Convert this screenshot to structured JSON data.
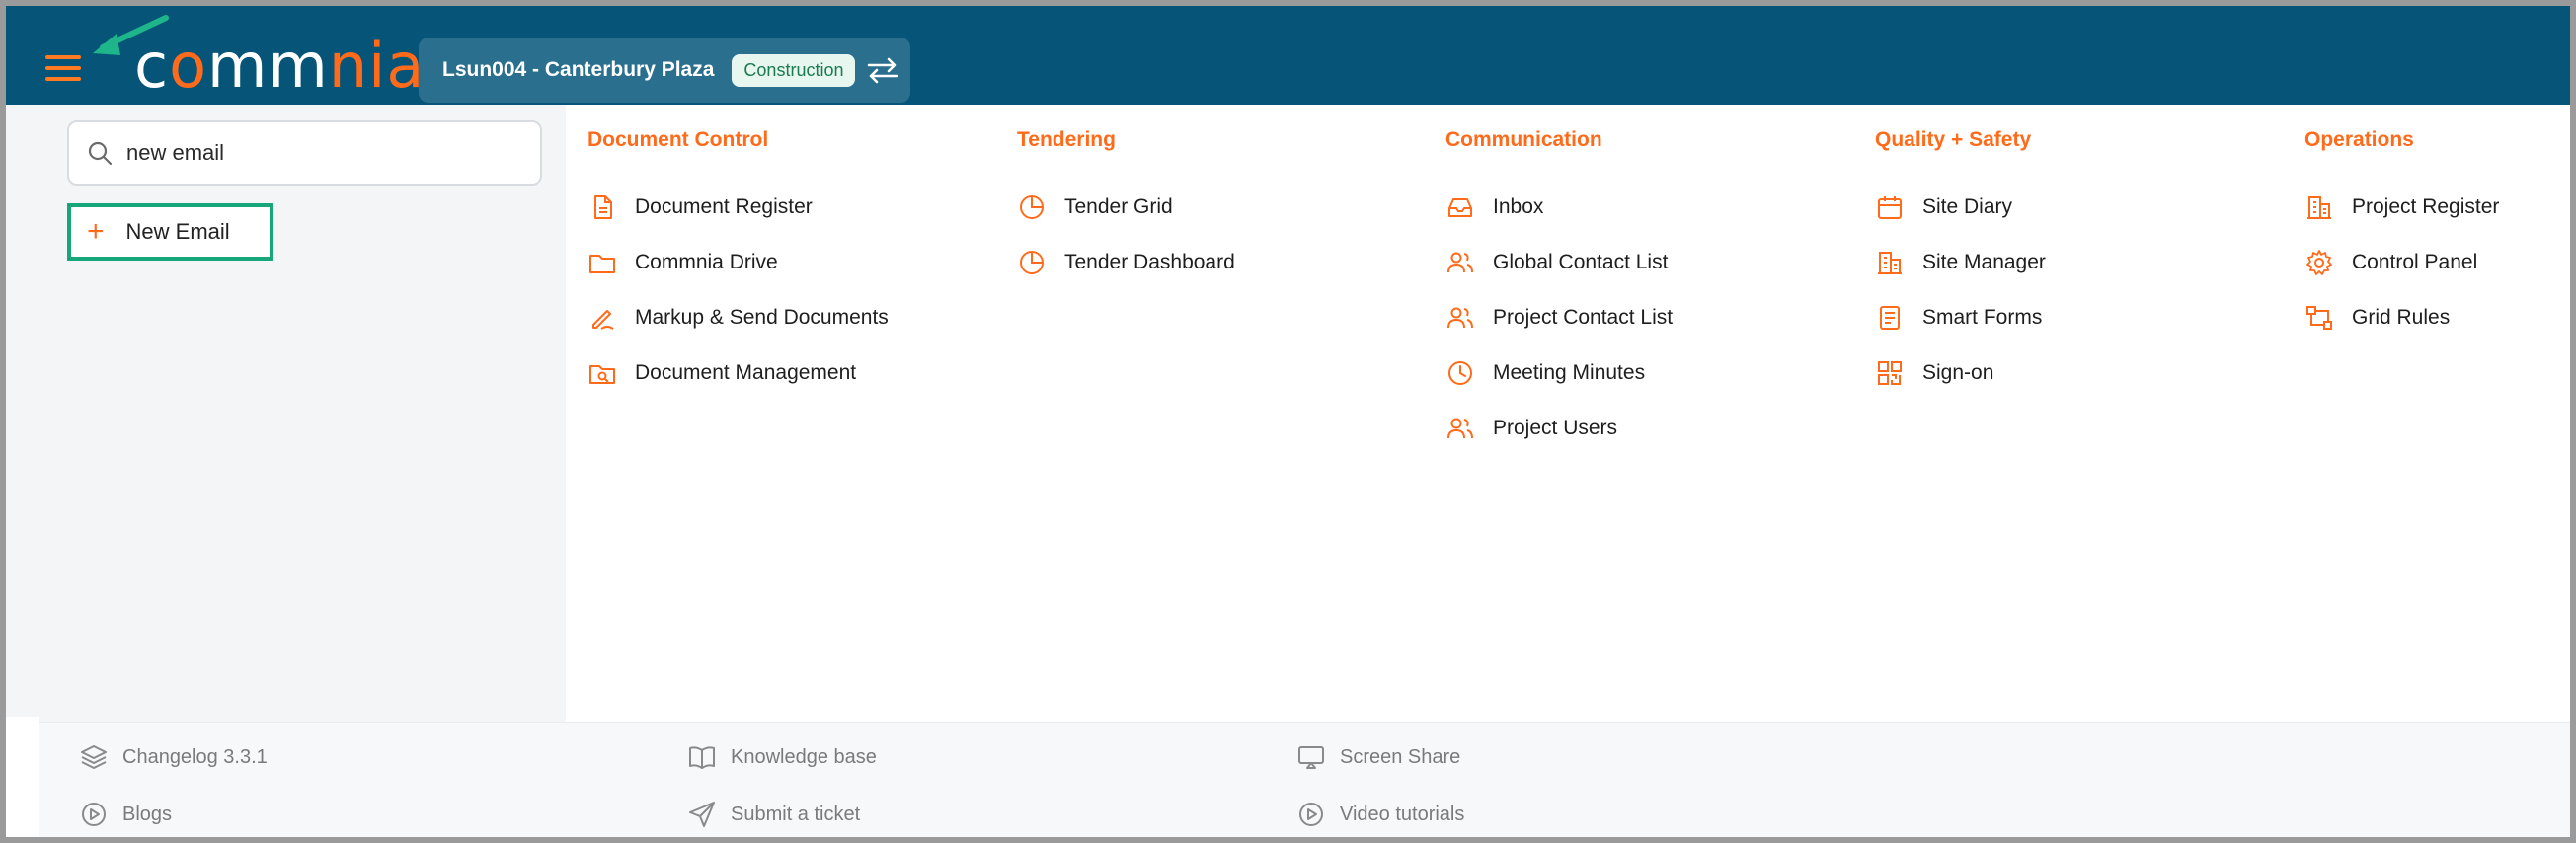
{
  "header": {
    "logo_text": "commnia",
    "project_name": "Lsun004 - Canterbury Plaza",
    "project_badge": "Construction",
    "brand_color": "#065478",
    "accent_color": "#ff6b1a"
  },
  "search": {
    "value": "new email"
  },
  "results": {
    "new_email_label": "New Email"
  },
  "columns": [
    {
      "title": "Document Control",
      "items": [
        "Document Register",
        "Commnia Drive",
        "Markup & Send Documents",
        "Document Management"
      ]
    },
    {
      "title": "Tendering",
      "items": [
        "Tender Grid",
        "Tender Dashboard"
      ]
    },
    {
      "title": "Communication",
      "items": [
        "Inbox",
        "Global Contact List",
        "Project Contact List",
        "Meeting Minutes",
        "Project Users"
      ]
    },
    {
      "title": "Quality + Safety",
      "items": [
        "Site Diary",
        "Site Manager",
        "Smart Forms",
        "Sign-on"
      ]
    },
    {
      "title": "Operations",
      "items": [
        "Project Register",
        "Control Panel",
        "Grid Rules"
      ]
    }
  ],
  "footer": {
    "changelog": "Changelog 3.3.1",
    "knowledge_base": "Knowledge base",
    "screen_share": "Screen Share",
    "blogs": "Blogs",
    "submit_ticket": "Submit a ticket",
    "video_tutorials": "Video tutorials"
  }
}
